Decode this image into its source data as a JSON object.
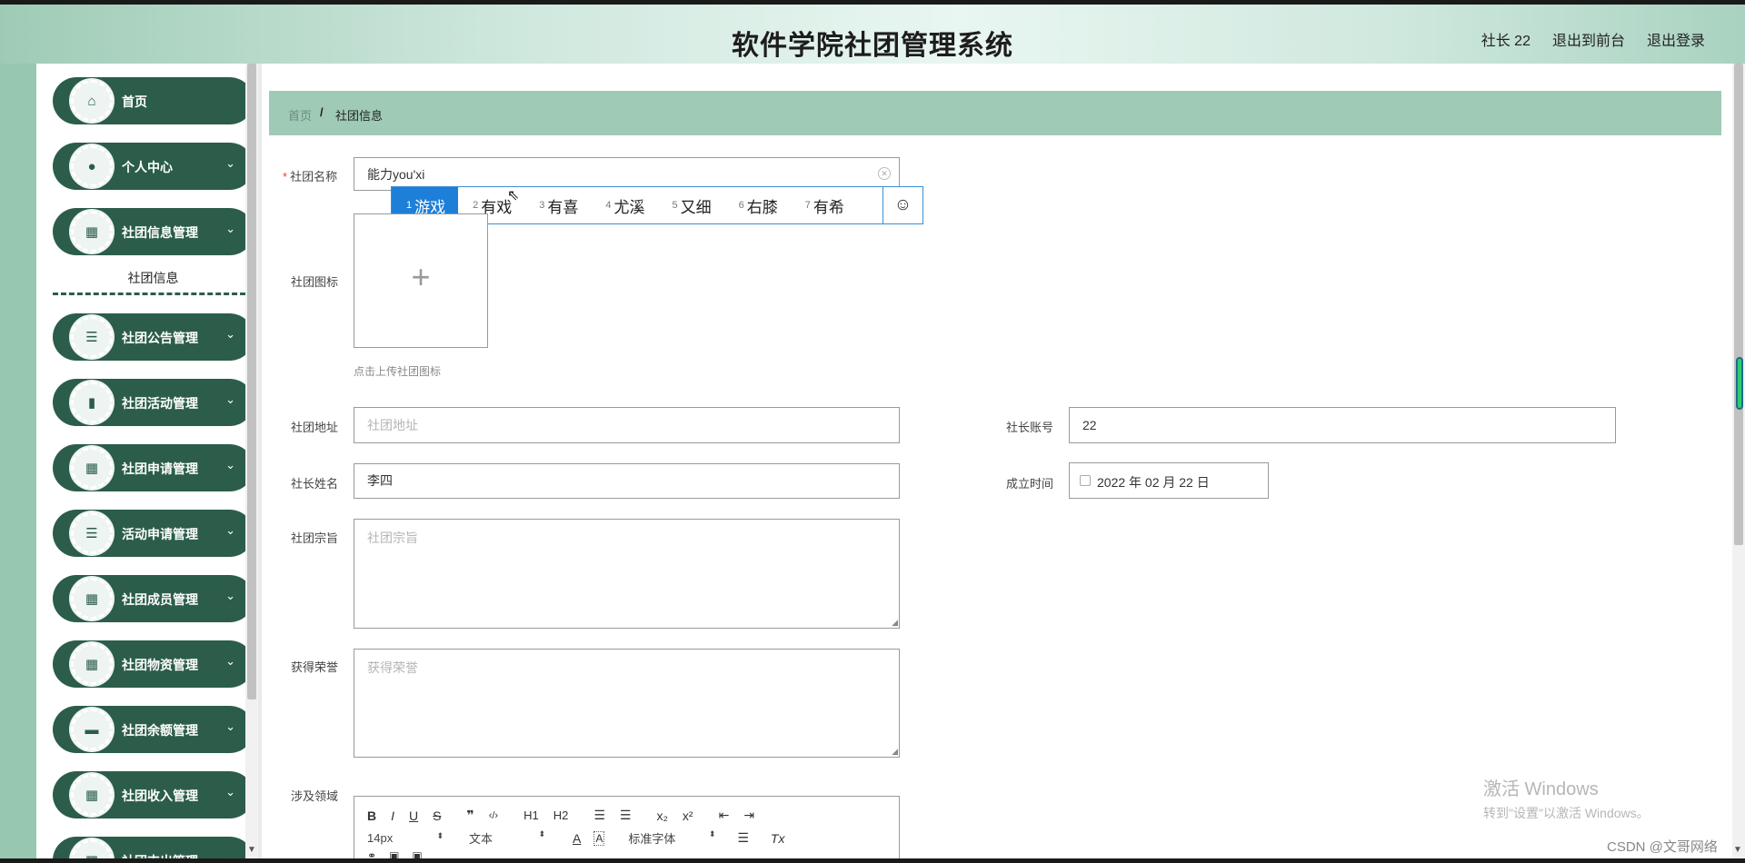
{
  "header": {
    "title": "软件学院社团管理系统",
    "user": "社长 22",
    "to_frontend": "退出到前台",
    "logout": "退出登录"
  },
  "sidebar": {
    "items": [
      {
        "label": "首页",
        "icon": "home-icon"
      },
      {
        "label": "个人中心",
        "icon": "user-icon"
      },
      {
        "label": "社团信息管理",
        "icon": "grid-icon"
      },
      {
        "label": "社团公告管理",
        "icon": "list-icon"
      },
      {
        "label": "社团活动管理",
        "icon": "bar-chart-icon"
      },
      {
        "label": "社团申请管理",
        "icon": "grid-icon"
      },
      {
        "label": "活动申请管理",
        "icon": "list-icon"
      },
      {
        "label": "社团成员管理",
        "icon": "grid-icon"
      },
      {
        "label": "社团物资管理",
        "icon": "grid-icon"
      },
      {
        "label": "社团余额管理",
        "icon": "briefcase-icon"
      },
      {
        "label": "社团收入管理",
        "icon": "grid-icon"
      },
      {
        "label": "社团支出管理",
        "icon": "grid-icon"
      }
    ],
    "submenu": {
      "label": "社团信息"
    }
  },
  "breadcrumb": {
    "home": "首页",
    "separator": "/",
    "current": "社团信息"
  },
  "form": {
    "name": {
      "label": "社团名称",
      "value": "能力you'xi"
    },
    "icon": {
      "label": "社团图标",
      "hint": "点击上传社团图标"
    },
    "address": {
      "label": "社团地址",
      "placeholder": "社团地址"
    },
    "leader_account": {
      "label": "社长账号",
      "value": "22"
    },
    "leader_name": {
      "label": "社长姓名",
      "value": "李四"
    },
    "founded": {
      "label": "成立时间",
      "value": "2022 年 02 月 22 日"
    },
    "purpose": {
      "label": "社团宗旨",
      "placeholder": "社团宗旨"
    },
    "honors": {
      "label": "获得荣誉",
      "placeholder": "获得荣誉"
    },
    "fields": {
      "label": "涉及领域"
    }
  },
  "ime": {
    "candidates": [
      {
        "num": "1",
        "text": "游戏"
      },
      {
        "num": "2",
        "text": "有戏"
      },
      {
        "num": "3",
        "text": "有喜"
      },
      {
        "num": "4",
        "text": "尤溪"
      },
      {
        "num": "5",
        "text": "又细"
      },
      {
        "num": "6",
        "text": "右膝"
      },
      {
        "num": "7",
        "text": "有希"
      }
    ],
    "emoji": "☺"
  },
  "editor": {
    "bold": "B",
    "italic": "I",
    "underline": "U",
    "strike": "S",
    "quote": "❞",
    "code": "‹/›",
    "h1": "H1",
    "h2": "H2",
    "ol": "☰",
    "ul": "☰",
    "sub": "x₂",
    "sup": "x²",
    "outdent": "⇤",
    "indent": "⇥",
    "size": "14px",
    "type": "文本",
    "font": "标准字体",
    "color": "A",
    "bg": "A",
    "align": "☰",
    "clear": "Tx"
  },
  "watermark": {
    "title": "激活 Windows",
    "subtitle": "转到\"设置\"以激活 Windows。"
  },
  "csdn": "CSDN @文哥网络",
  "colors": {
    "primary": "#2b5d4a",
    "breadcrumb": "#9fcab6",
    "ime_active": "#1e7fd8"
  }
}
